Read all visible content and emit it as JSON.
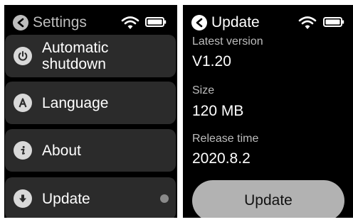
{
  "colors": {
    "screen_bg": "#000000",
    "item_bg": "#2b2b2b",
    "icon_fill": "#d9d9d9",
    "button_bg": "#b2b2b2"
  },
  "settings_screen": {
    "title": "Settings",
    "status_icons": [
      "wifi-icon",
      "battery-icon"
    ],
    "items": [
      {
        "label": "Automatic shutdown",
        "icon": "power-icon"
      },
      {
        "label": "Language",
        "icon": "letter-a-icon"
      },
      {
        "label": "About",
        "icon": "info-icon"
      },
      {
        "label": "Update",
        "icon": "download-arrow-icon",
        "indicator": "dot"
      }
    ]
  },
  "update_screen": {
    "title": "Update",
    "status_icons": [
      "wifi-icon",
      "battery-icon"
    ],
    "fields": [
      {
        "label": "Latest version",
        "value": "V1.20"
      },
      {
        "label": "Size",
        "value": "120 MB"
      },
      {
        "label": "Release time",
        "value": "2020.8.2"
      }
    ],
    "button_label": "Update"
  }
}
